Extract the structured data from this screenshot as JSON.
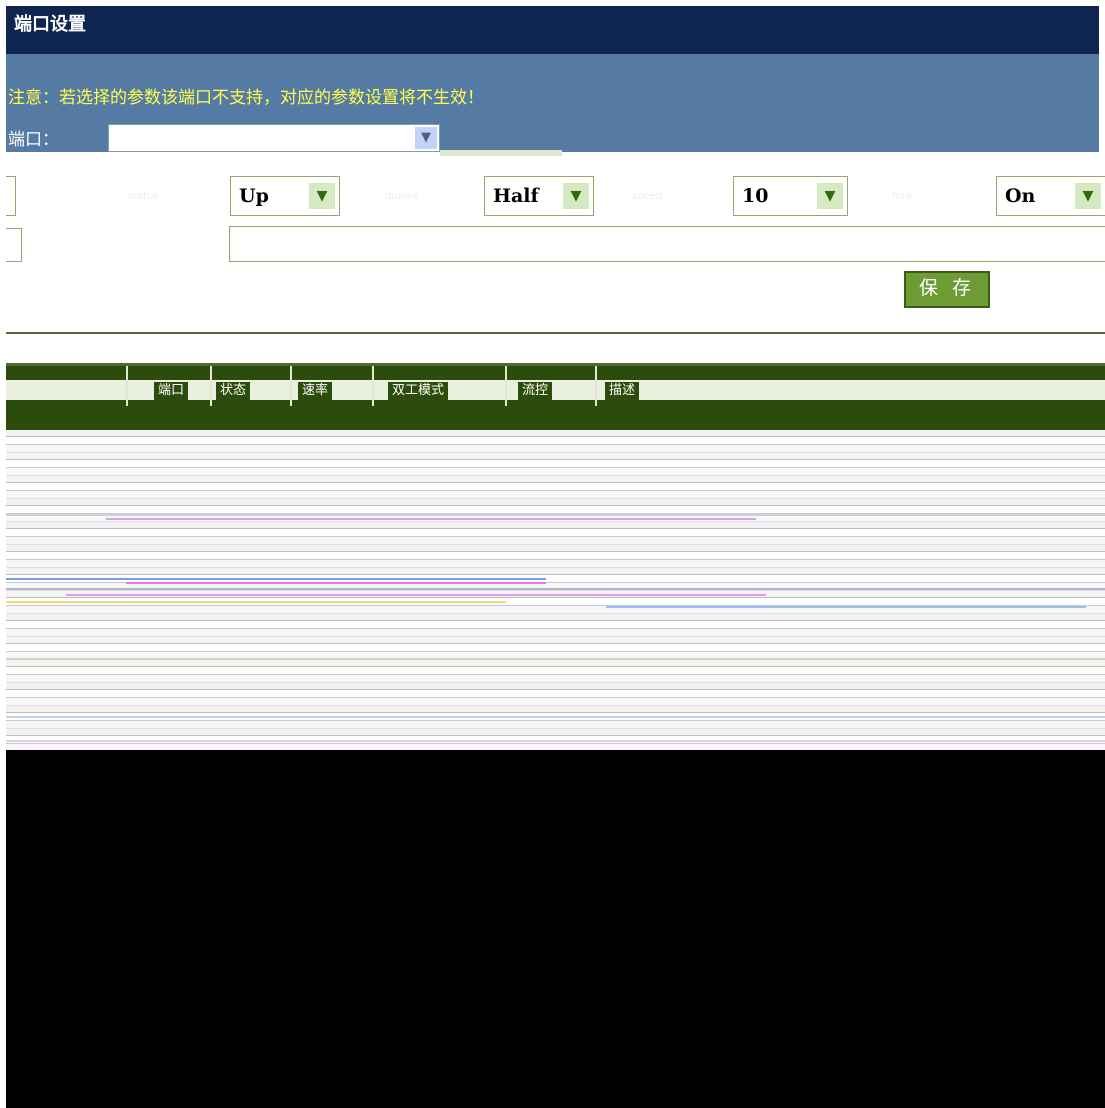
{
  "title": "端口设置",
  "notice": "注意：若选择的参数该端口不支持，对应的参数设置将不生效！",
  "port": {
    "label": "端口：",
    "value": ""
  },
  "settings": {
    "link_label": "status",
    "link_value": "Up",
    "duplex_label": "duplex",
    "duplex_value": "Half",
    "speed_label": "speed",
    "speed_value": "10",
    "flow_label": "flow",
    "flow_value": "On"
  },
  "save_label": "保 存",
  "table": {
    "headers": [
      "端口",
      "状态",
      "速率",
      "双工模式",
      "流控",
      "描述"
    ]
  },
  "colors": {
    "title_bg": "#0e2550",
    "panel_bg": "#557aa4",
    "notice_text": "#ffff4d",
    "table_header_bg": "#2c4c0c",
    "button_bg": "#6f9b35"
  }
}
